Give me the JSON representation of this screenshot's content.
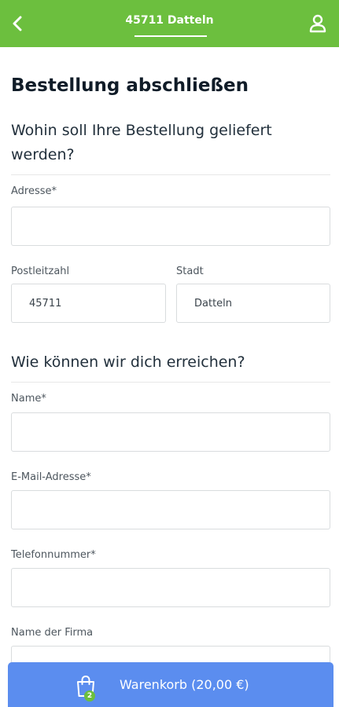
{
  "header": {
    "location": "45711 Datteln",
    "back_icon": "chevron-left-icon",
    "user_icon": "user-icon",
    "color": "#6cbf3e"
  },
  "page": {
    "title": "Bestellung abschließen"
  },
  "delivery": {
    "heading": "Wohin soll Ihre Bestellung geliefert werden?",
    "address_label": "Adresse*",
    "address_value": "",
    "postal_label": "Postleitzahl",
    "postal_value": "45711",
    "city_label": "Stadt",
    "city_value": "Datteln"
  },
  "contact": {
    "heading": "Wie können wir dich erreichen?",
    "name_label": "Name*",
    "name_value": "",
    "email_label": "E-Mail-Adresse*",
    "email_value": "",
    "phone_label": "Telefonnummer*",
    "phone_value": "",
    "company_label": "Name der Firma",
    "company_value": ""
  },
  "cart": {
    "label": "Warenkorb (20,00 €)",
    "count": "2",
    "icon": "shopping-bag-icon",
    "color": "#5b8def",
    "badge_color": "#6cbf3e"
  }
}
